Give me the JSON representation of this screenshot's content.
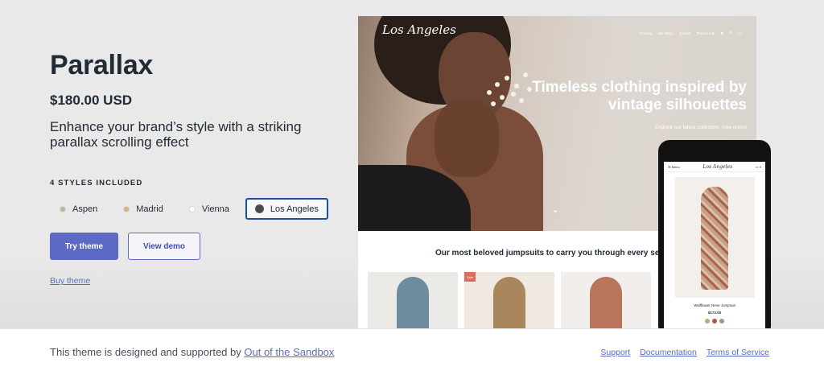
{
  "theme": {
    "title": "Parallax",
    "price": "$180.00 USD",
    "description": "Enhance your brand’s style with a striking parallax scrolling effect",
    "styles_heading": "4 STYLES INCLUDED",
    "styles": [
      {
        "label": "Aspen",
        "color": "#c2b59b"
      },
      {
        "label": "Madrid",
        "color": "#d4b27c"
      },
      {
        "label": "Vienna",
        "color": "#ffffff"
      },
      {
        "label": "Los Angeles",
        "color": "#4a4a4a",
        "selected": true
      }
    ],
    "try_button": "Try theme",
    "demo_button": "View demo",
    "buy_link": "Buy theme"
  },
  "preview": {
    "desktop": {
      "logo": "Los Angeles",
      "nav": [
        "Catalog",
        "Our Story",
        "Journal",
        "Theme Info"
      ],
      "headline": "Timeless clothing inspired by vintage silhouettes",
      "subheadline": "Explore our latest collection, now online",
      "section_title": "Our most beloved jumpsuits to carry you through every se",
      "sale_badge": "Sale"
    },
    "mobile": {
      "menu": "Menu",
      "logo": "Los Angeles",
      "product_name": "Wallflower Neve Jumpsuit",
      "product_price": "$172.00",
      "swatches": [
        "#c9a27e",
        "#b5554a",
        "#8a9aa6"
      ]
    }
  },
  "footer": {
    "text": "This theme is designed and supported by",
    "author_link": "Out of the Sandbox",
    "links": [
      "Support",
      "Documentation",
      "Terms of Service"
    ]
  },
  "colors": {
    "accent": "#5c6ac4",
    "selected_border": "#1f5199"
  }
}
